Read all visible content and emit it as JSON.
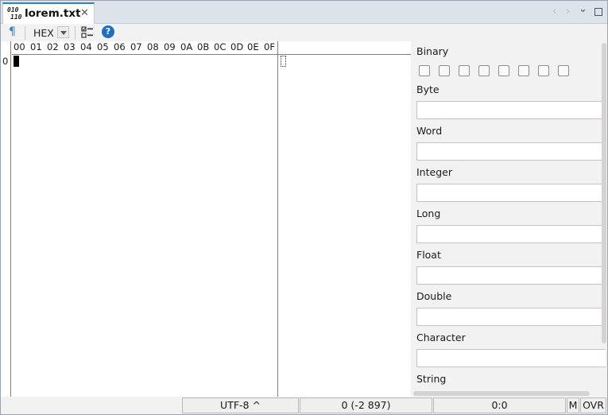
{
  "tab": {
    "title": "lorem.txt",
    "icon": "binary-file-icon",
    "icon_text_top": "010",
    "icon_text_bottom": "110",
    "close_glyph": "✕"
  },
  "window_controls": {
    "prev": "‹",
    "next": "›",
    "menu": "⌄"
  },
  "toolbar": {
    "show_unprintables_glyph": "¶",
    "code_type": "HEX",
    "help_glyph": "?"
  },
  "hex": {
    "columns": [
      "00",
      "01",
      "02",
      "03",
      "04",
      "05",
      "06",
      "07",
      "08",
      "09",
      "0A",
      "0B",
      "0C",
      "0D",
      "0E",
      "0F"
    ],
    "rows": [
      "0"
    ]
  },
  "values_panel": {
    "binary_label": "Binary",
    "bits": [
      false,
      false,
      false,
      false,
      false,
      false,
      false,
      false
    ],
    "fields": [
      {
        "label": "Byte",
        "value": ""
      },
      {
        "label": "Word",
        "value": ""
      },
      {
        "label": "Integer",
        "value": ""
      },
      {
        "label": "Long",
        "value": ""
      },
      {
        "label": "Float",
        "value": ""
      },
      {
        "label": "Double",
        "value": ""
      },
      {
        "label": "Character",
        "value": ""
      }
    ],
    "string_label": "String"
  },
  "status": {
    "encoding": "UTF-8 ^",
    "position": "0 (-2 897)",
    "cursor": "0:0",
    "mode_m": "M",
    "mode_ovr": "OVR"
  }
}
